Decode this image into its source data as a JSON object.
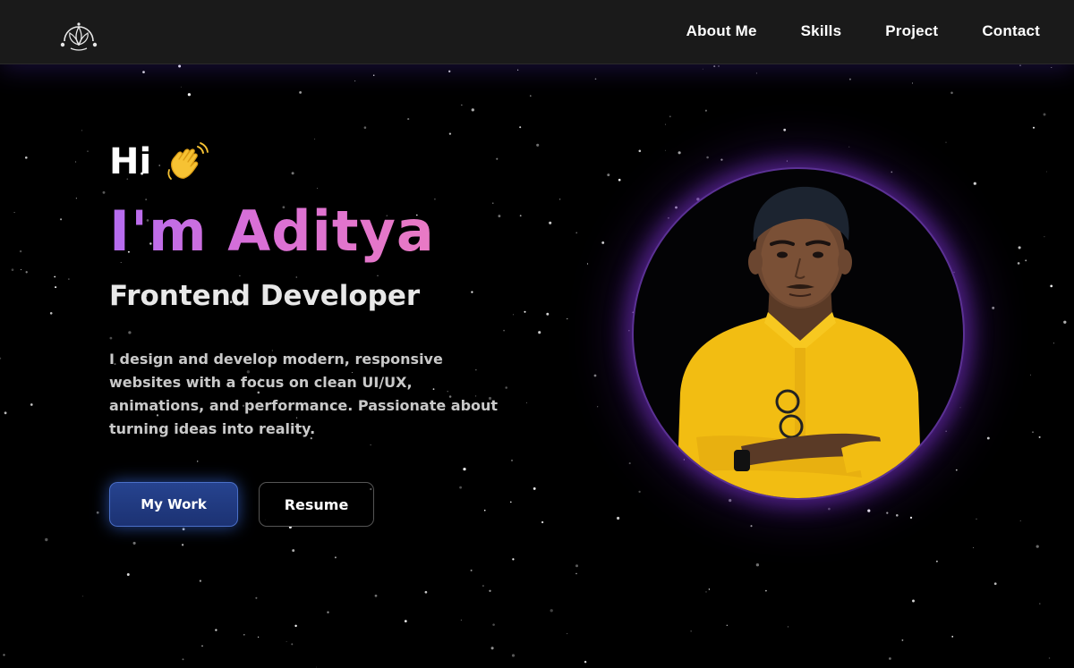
{
  "nav": {
    "logo_icon": "lotus-logo-icon",
    "links": [
      "About Me",
      "Skills",
      "Project",
      "Contact"
    ]
  },
  "hero": {
    "greeting": "Hi",
    "wave_icon": "waving-hand-icon",
    "name": "I'm Aditya",
    "role": "Frontend Developer",
    "description": "I design and develop modern, responsive websites with a focus on clean UI/UX, animations, and performance. Passionate about turning ideas into reality.",
    "primary_button": "My Work",
    "secondary_button": "Resume",
    "portrait_icon": "profile-photo"
  },
  "colors": {
    "background": "#000000",
    "navbar": "#1a1a1a",
    "name_gradient_start": "#b46cf0",
    "name_gradient_end": "#e97ac4",
    "primary_button": "#26438f",
    "portrait_glow": "#7a32c8"
  }
}
